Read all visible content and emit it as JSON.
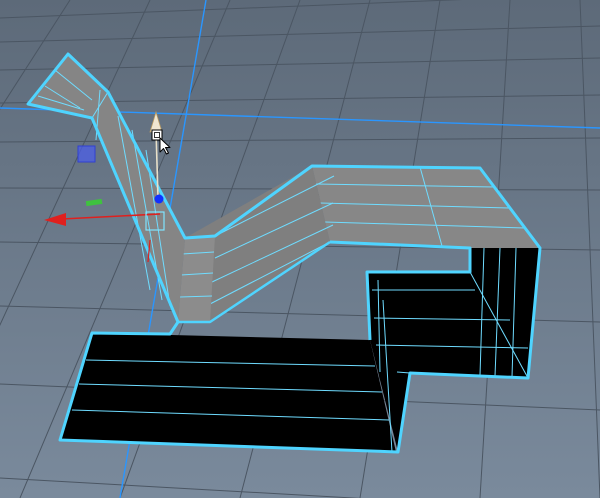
{
  "viewport": {
    "background_top": "#5d6a79",
    "background_bottom": "#7a8a9c",
    "grid_color": "#4a5560",
    "axis_highlight_color": "#1e90ff",
    "selection_outline_color": "#4fd4ff",
    "wire_color": "#7fe3ff",
    "face_gray": "#8a8a8a",
    "face_black": "#000000"
  },
  "manipulator": {
    "tool": "move-tool",
    "x_axis_color": "#e0201e",
    "y_axis_color": "#e8e0c8",
    "z_axis_color": "#2040ff",
    "plane_handle_color": "#5060ff",
    "pivot_color": "#1030ff",
    "green_handle_color": "#40c040"
  },
  "cursor": {
    "icon": "move-cursor-icon"
  }
}
